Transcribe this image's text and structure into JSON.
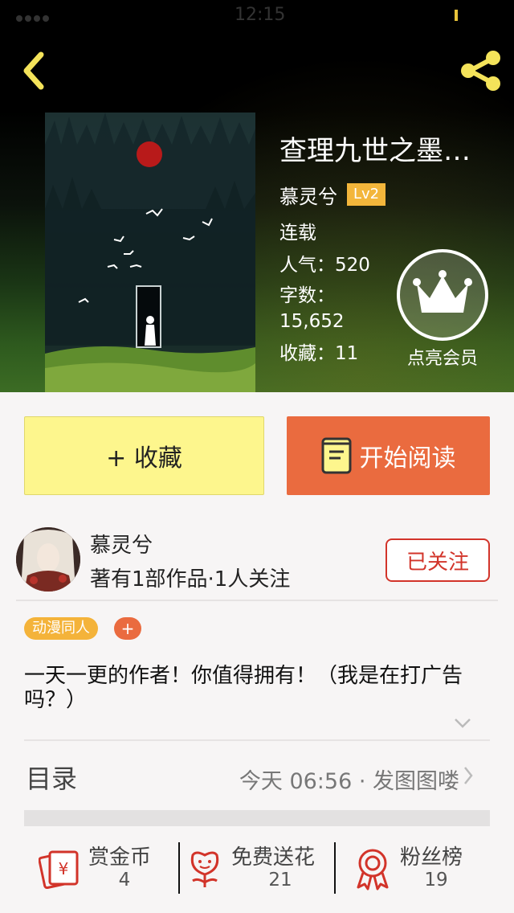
{
  "status_bar": {
    "time": "12:15"
  },
  "book": {
    "title": "查理九世之墨…",
    "author": "慕灵兮",
    "level": "Lv2",
    "status": "连载",
    "popularity": "人气：520",
    "word_count": "字数：15,652",
    "favorites": "收藏：11"
  },
  "vip": {
    "label": "点亮会员"
  },
  "actions": {
    "favorite": "+ 收藏",
    "read": "开始阅读"
  },
  "author_card": {
    "name": "慕灵兮",
    "stats": "著有1部作品·1人关注",
    "follow_label": "已关注"
  },
  "tags": {
    "items": [
      "动漫同人"
    ],
    "add_label": "+"
  },
  "intro": "一天一更的作者！你值得拥有！（我是在打广告吗？）",
  "catalog": {
    "title": "目录",
    "latest": "今天 06:56 · 发图图喽"
  },
  "stats": [
    {
      "label": "赏金币",
      "value": "4",
      "icon": "red-envelope-yen-icon"
    },
    {
      "label": "免费送花",
      "value": "21",
      "icon": "flower-icon"
    },
    {
      "label": "粉丝榜",
      "value": "19",
      "icon": "medal-icon"
    }
  ],
  "colors": {
    "accent_orange": "#ea6b3f",
    "favorite_yellow": "#fdf68d",
    "level_badge": "#f3b63b",
    "follow_red": "#d2342a",
    "icon_yellow": "#f4e35a"
  }
}
